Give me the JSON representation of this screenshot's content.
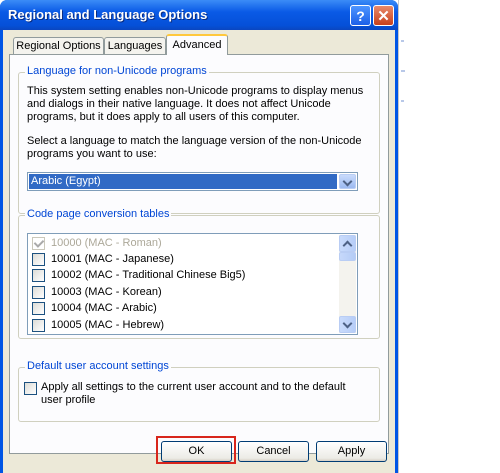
{
  "window": {
    "title": "Regional and Language Options"
  },
  "tabs": [
    {
      "label": "Regional Options",
      "active": false
    },
    {
      "label": "Languages",
      "active": false
    },
    {
      "label": "Advanced",
      "active": true
    }
  ],
  "non_unicode": {
    "group_label": "Language for non-Unicode programs",
    "description_lines": [
      "This system setting enables non-Unicode programs to display menus",
      "and dialogs in their native language. It does not affect Unicode",
      "programs, but it does apply to all users of this computer."
    ],
    "prompt_lines": [
      "Select a language to match the language version of the non-Unicode",
      "programs you want to use:"
    ],
    "selected_language": "Arabic (Egypt)"
  },
  "code_pages": {
    "group_label": "Code page conversion tables",
    "items": [
      {
        "label": "10000 (MAC - Roman)",
        "checked": true,
        "disabled": true
      },
      {
        "label": "10001 (MAC - Japanese)",
        "checked": false,
        "disabled": false
      },
      {
        "label": "10002 (MAC - Traditional Chinese Big5)",
        "checked": false,
        "disabled": false
      },
      {
        "label": "10003 (MAC - Korean)",
        "checked": false,
        "disabled": false
      },
      {
        "label": "10004 (MAC - Arabic)",
        "checked": false,
        "disabled": false
      },
      {
        "label": "10005 (MAC - Hebrew)",
        "checked": false,
        "disabled": false
      }
    ]
  },
  "default_user": {
    "group_label": "Default user account settings",
    "checkbox_lines": [
      "Apply all settings to the current user account and to the default",
      "user profile"
    ],
    "checked": false
  },
  "buttons": {
    "ok": "OK",
    "cancel": "Cancel",
    "apply": "Apply"
  },
  "title_buttons": {
    "help": "?",
    "close": "✕"
  },
  "colors": {
    "titlebar": "#0a5ae6",
    "dialog_face": "#ece9d8",
    "selection": "#316ac5",
    "highlight_outline": "#d8261c",
    "group_label": "#0046d5"
  }
}
